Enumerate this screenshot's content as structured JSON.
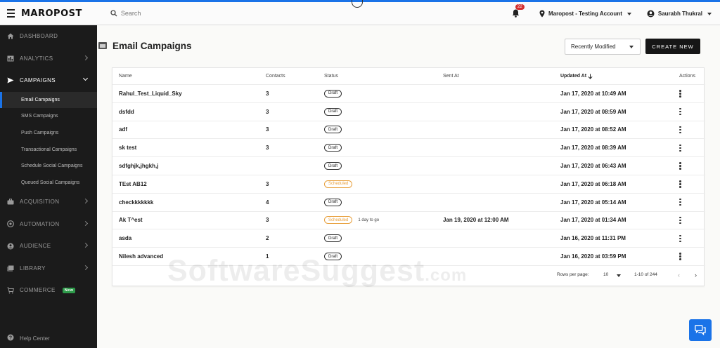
{
  "app": {
    "brand": "MAROPOST"
  },
  "topbar": {
    "search_placeholder": "Search",
    "notification_count": "22",
    "account": "Maropost - Testing Account",
    "user": "Saurabh Thukral"
  },
  "sidebar": {
    "items": [
      {
        "label": "DASHBOARD"
      },
      {
        "label": "ANALYTICS"
      },
      {
        "label": "CAMPAIGNS"
      },
      {
        "label": "ACQUISITION"
      },
      {
        "label": "AUTOMATION"
      },
      {
        "label": "AUDIENCE"
      },
      {
        "label": "LIBRARY"
      },
      {
        "label": "COMMERCE",
        "badge": "New"
      }
    ],
    "subitems": [
      {
        "label": "Email Campaigns"
      },
      {
        "label": "SMS Campaigns"
      },
      {
        "label": "Push Campaigns"
      },
      {
        "label": "Transactional Campaigns"
      },
      {
        "label": "Schedule Social Campaigns"
      },
      {
        "label": "Queued Social Campaigns"
      }
    ],
    "help": "Help Center"
  },
  "page": {
    "title": "Email Campaigns",
    "sort_value": "Recently Modified",
    "create_label": "CREATE NEW"
  },
  "table": {
    "headers": {
      "name": "Name",
      "contacts": "Contacts",
      "status": "Status",
      "sent_at": "Sent At",
      "updated_at": "Updated At",
      "actions": "Actions"
    },
    "rows": [
      {
        "name": "Rahul_Test_Liquid_Sky",
        "contacts": "3",
        "status": "Draft",
        "note": "",
        "sent_at": "",
        "updated_at": "Jan 17, 2020 at 10:49 AM"
      },
      {
        "name": "dsfdd",
        "contacts": "3",
        "status": "Draft",
        "note": "",
        "sent_at": "",
        "updated_at": "Jan 17, 2020 at 08:59 AM"
      },
      {
        "name": "adf",
        "contacts": "3",
        "status": "Draft",
        "note": "",
        "sent_at": "",
        "updated_at": "Jan 17, 2020 at 08:52 AM"
      },
      {
        "name": "sk test",
        "contacts": "3",
        "status": "Draft",
        "note": "",
        "sent_at": "",
        "updated_at": "Jan 17, 2020 at 08:39 AM"
      },
      {
        "name": "sdfghjk,jhgkh,j",
        "contacts": "",
        "status": "Draft",
        "note": "",
        "sent_at": "",
        "updated_at": "Jan 17, 2020 at 06:43 AM"
      },
      {
        "name": "TEst AB12",
        "contacts": "3",
        "status": "Scheduled",
        "note": "",
        "sent_at": "",
        "updated_at": "Jan 17, 2020 at 06:18 AM"
      },
      {
        "name": "checkkkkkkk",
        "contacts": "4",
        "status": "Draft",
        "note": "",
        "sent_at": "",
        "updated_at": "Jan 17, 2020 at 05:14 AM"
      },
      {
        "name": "Ak T^est",
        "contacts": "3",
        "status": "Scheduled",
        "note": "1 day to go",
        "sent_at": "Jan 19, 2020 at 12:00 AM",
        "updated_at": "Jan 17, 2020 at 01:34 AM"
      },
      {
        "name": "asda",
        "contacts": "2",
        "status": "Draft",
        "note": "",
        "sent_at": "",
        "updated_at": "Jan 16, 2020 at 11:31 PM"
      },
      {
        "name": "Nilesh advanced",
        "contacts": "1",
        "status": "Draft",
        "note": "",
        "sent_at": "",
        "updated_at": "Jan 16, 2020 at 03:59 PM"
      }
    ]
  },
  "pagination": {
    "rows_per_page_label": "Rows per page:",
    "rows_per_page": "10",
    "range": "1-10 of 244"
  },
  "watermark": {
    "text": "SoftwareSuggest",
    "suffix": ".com"
  },
  "colors": {
    "accent": "#1a73e8",
    "sidebar_bg": "#1b1b1b",
    "scheduled": "#e8a03c",
    "new_badge": "#2e9b4a"
  }
}
